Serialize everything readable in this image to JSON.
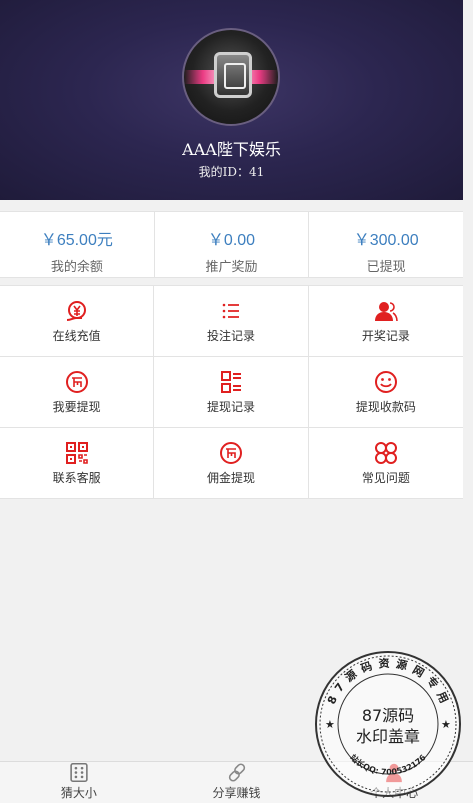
{
  "profile": {
    "name": "AAA陛下娱乐",
    "id_label": "我的ID：41"
  },
  "stats": [
    {
      "value": "￥65.00元",
      "label": "我的余额"
    },
    {
      "value": "￥0.00",
      "label": "推广奖励"
    },
    {
      "value": "￥300.00",
      "label": "已提现"
    }
  ],
  "menu": [
    {
      "label": "在线充值",
      "icon": "recharge-icon"
    },
    {
      "label": "投注记录",
      "icon": "list-icon"
    },
    {
      "label": "开奖记录",
      "icon": "user-icon"
    },
    {
      "label": "我要提现",
      "icon": "coin-icon"
    },
    {
      "label": "提现记录",
      "icon": "record-icon"
    },
    {
      "label": "提现收款码",
      "icon": "smile-icon"
    },
    {
      "label": "联系客服",
      "icon": "qrcode-icon"
    },
    {
      "label": "佣金提现",
      "icon": "coin-icon"
    },
    {
      "label": "常见问题",
      "icon": "help-icon"
    }
  ],
  "tabs": [
    {
      "label": "猜大小",
      "icon": "dice-icon"
    },
    {
      "label": "分享赚钱",
      "icon": "link-icon"
    },
    {
      "label": "个人中心",
      "icon": "person-icon"
    }
  ],
  "colors": {
    "accent": "#e02020",
    "value_blue": "#3d7fbf",
    "header": "#2c2650"
  },
  "watermark": {
    "line1": "87源码",
    "line2": "水印盖章",
    "ring": "8 7 源 码 资 源 网 专 用",
    "qq": "站长QQ: 700532176"
  }
}
